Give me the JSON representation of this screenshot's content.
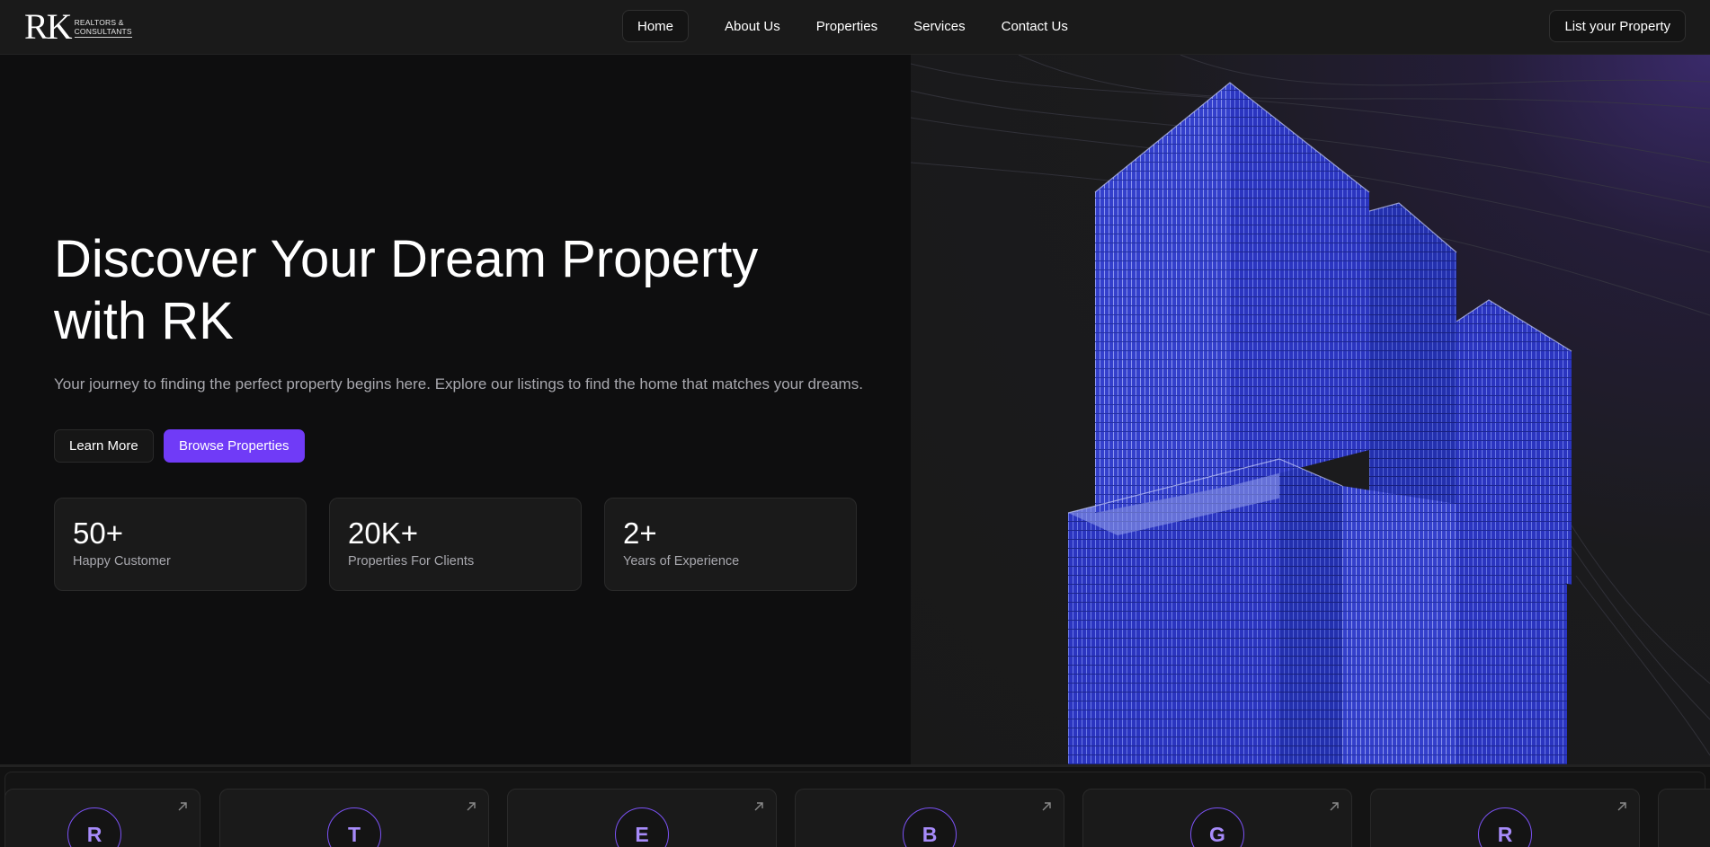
{
  "nav": {
    "logo_mark": "RK",
    "logo_line1": "REALTORS &",
    "logo_line2": "CONSULTANTS",
    "links": [
      "Home",
      "About Us",
      "Properties",
      "Services",
      "Contact Us"
    ],
    "active": "Home",
    "cta_label": "List your Property"
  },
  "hero": {
    "title_line1": "Discover Your Dream Property",
    "title_line2": "with RK",
    "description": "Your journey to finding the perfect property begins here. Explore our listings to find the home that matches your dreams.",
    "learn_more_label": "Learn More",
    "browse_label": "Browse Properties",
    "stats": [
      {
        "value": "50+",
        "label": "Happy Customer"
      },
      {
        "value": "20K+",
        "label": "Properties For Clients"
      },
      {
        "value": "2+",
        "label": "Years of Experience"
      }
    ]
  },
  "strip": {
    "cards": [
      {
        "letter": "R"
      },
      {
        "letter": "T"
      },
      {
        "letter": "E"
      },
      {
        "letter": "B"
      },
      {
        "letter": "G"
      },
      {
        "letter": "R"
      }
    ]
  },
  "colors": {
    "accent": "#703bf7",
    "background": "#141414",
    "surface": "#1a1a1a",
    "text_muted": "#a8a8ae",
    "building_blue": "#2d3ac8"
  },
  "icons": {
    "strip_arrow": "arrow-up-right-icon"
  }
}
